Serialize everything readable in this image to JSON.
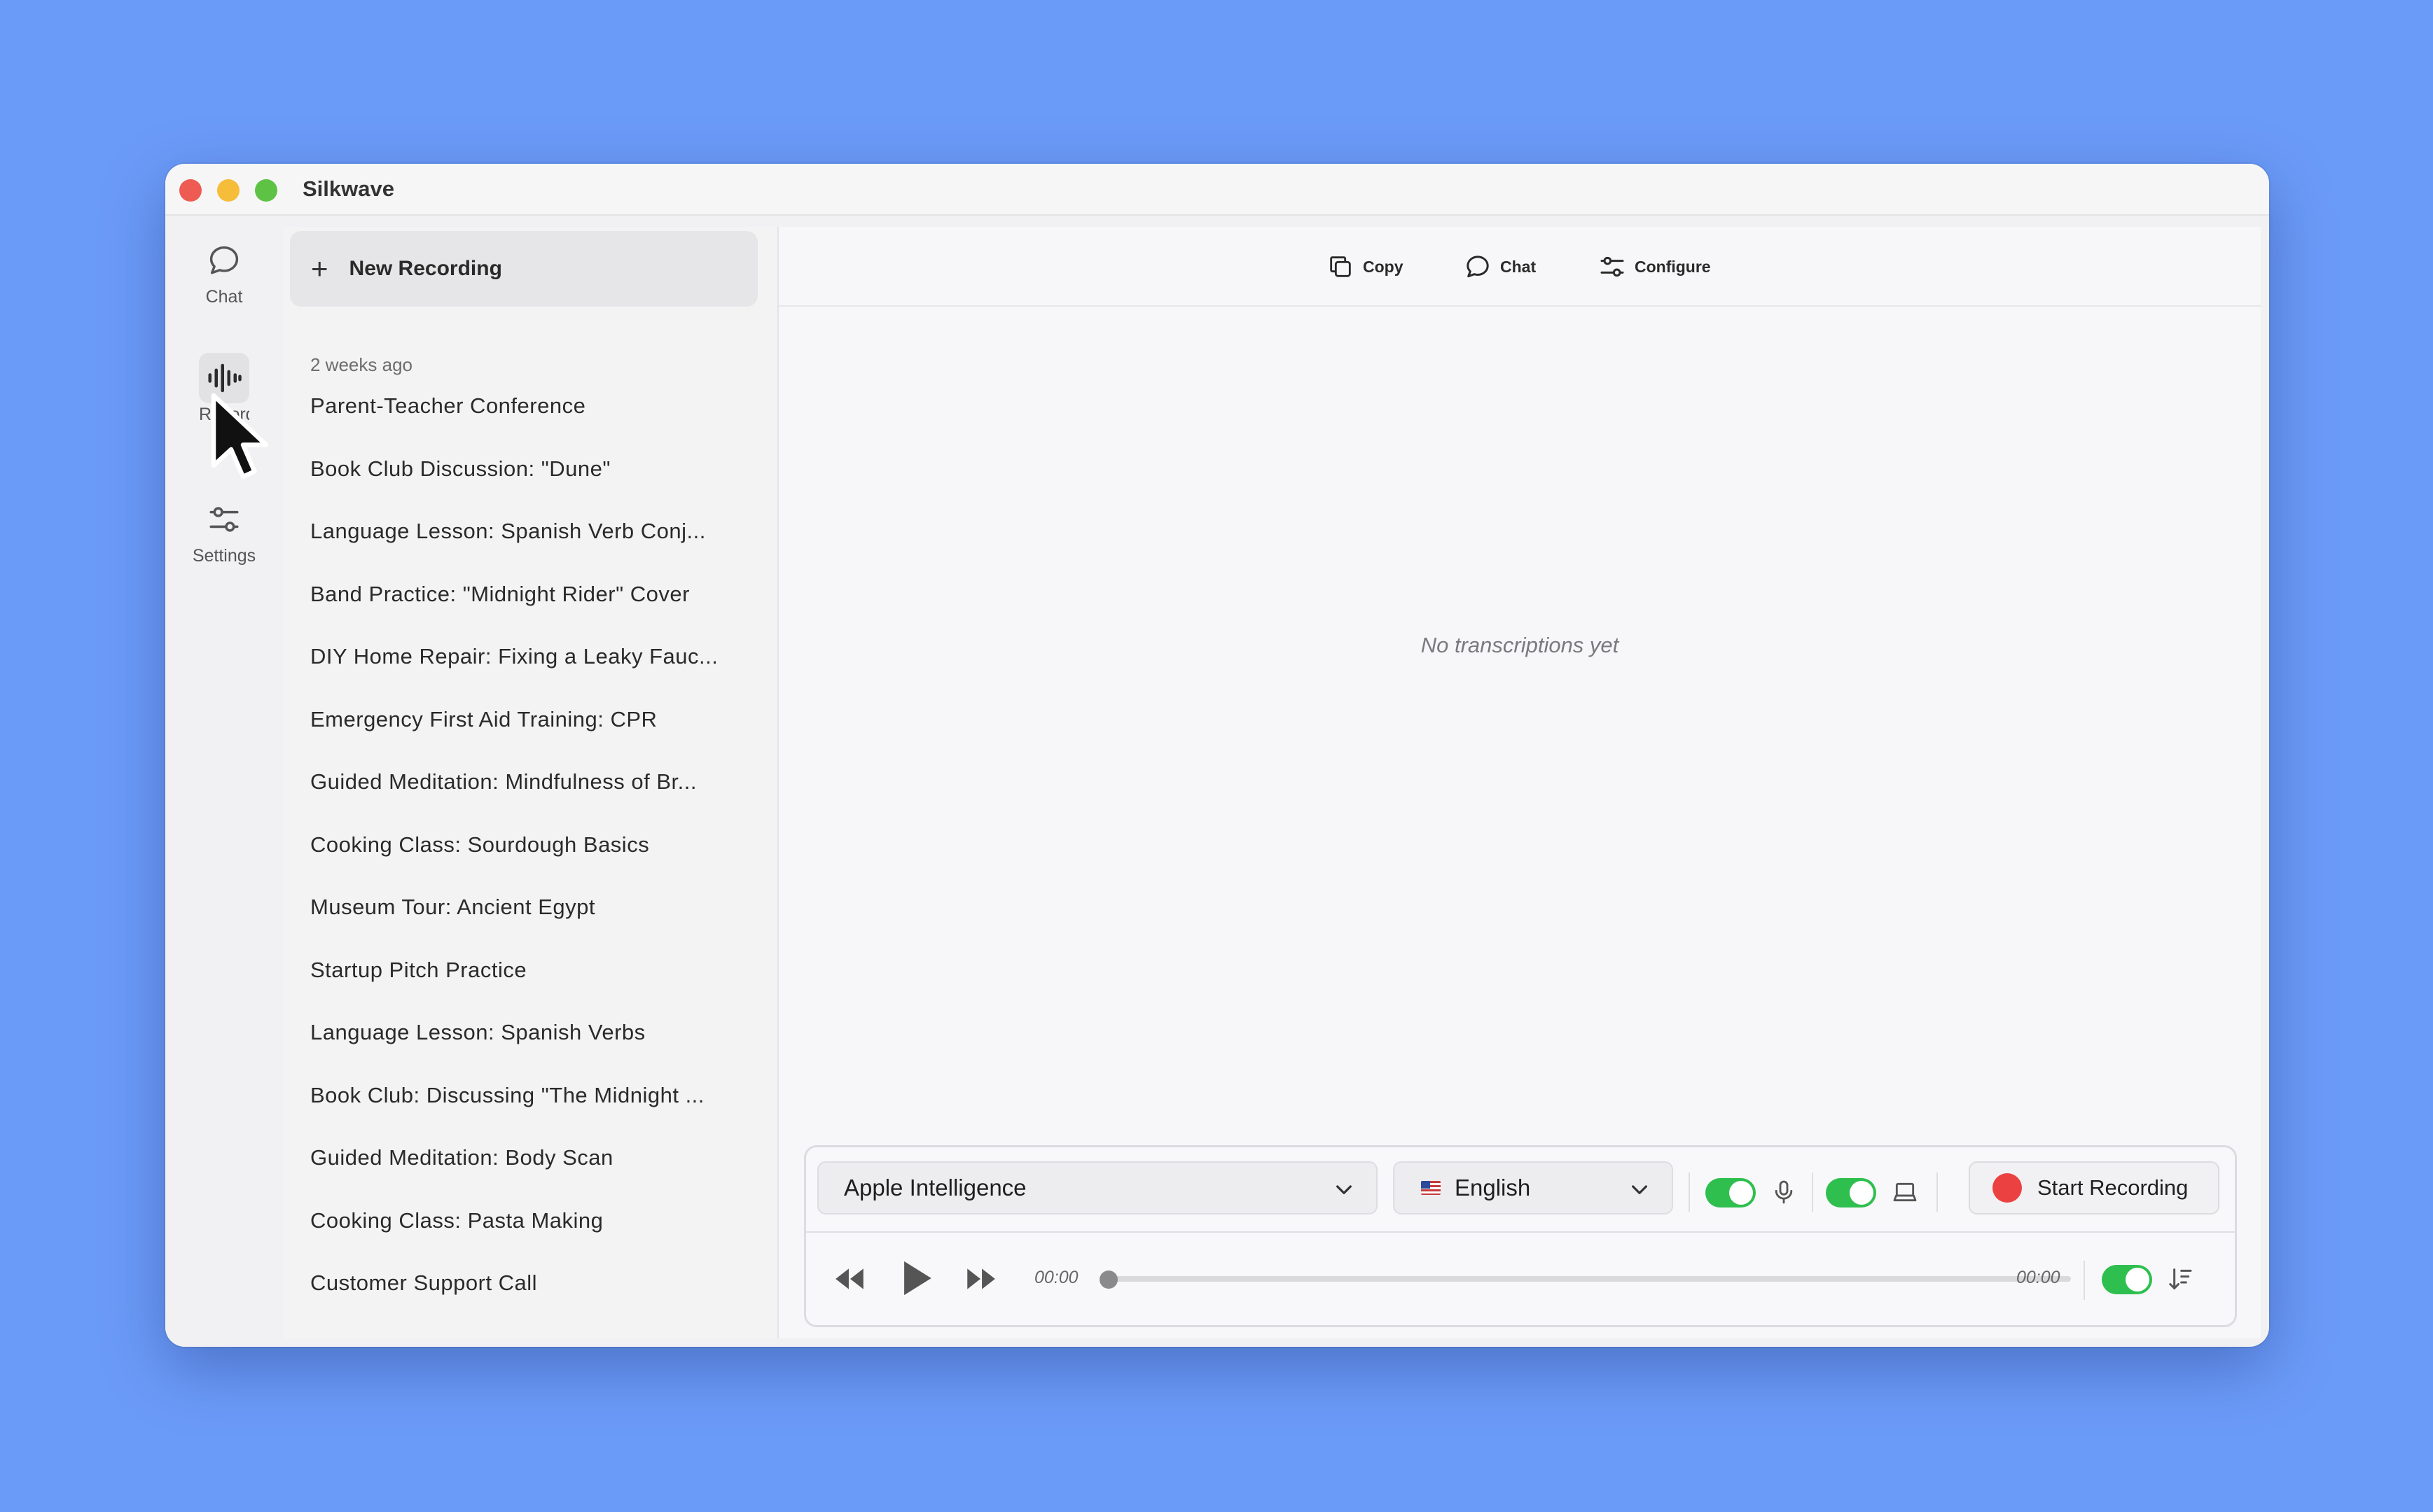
{
  "window": {
    "title": "Silkwave"
  },
  "rail": {
    "items": [
      {
        "label": "Chat",
        "icon": "chat-bubble-icon"
      },
      {
        "label": "Recordings",
        "icon": "waveform-icon",
        "active": true
      },
      {
        "label": "Settings",
        "icon": "sliders-icon"
      }
    ]
  },
  "list": {
    "new_button": "New Recording",
    "group_label": "2 weeks ago",
    "items": [
      "Parent-Teacher Conference",
      "Book Club Discussion: \"Dune\"",
      "Language Lesson: Spanish Verb Conj...",
      "Band Practice: \"Midnight Rider\" Cover",
      "DIY Home Repair: Fixing a Leaky Fauc...",
      "Emergency First Aid Training: CPR",
      "Guided Meditation: Mindfulness of Br...",
      "Cooking Class: Sourdough Basics",
      "Museum Tour: Ancient Egypt",
      "Startup Pitch Practice",
      "Language Lesson: Spanish Verbs",
      "Book Club: Discussing \"The Midnight ...",
      "Guided Meditation: Body Scan",
      "Cooking Class: Pasta Making",
      "Customer Support Call"
    ]
  },
  "toolbar": {
    "copy": "Copy",
    "chat": "Chat",
    "configure": "Configure"
  },
  "main": {
    "empty_text": "No transcriptions yet"
  },
  "controls": {
    "model": "Apple Intelligence",
    "language": "English",
    "mic_toggle_on": true,
    "system_audio_toggle_on": true,
    "record_button": "Start Recording",
    "time_current": "00:00",
    "time_total": "00:00",
    "autoscroll_toggle_on": true,
    "progress": 0
  },
  "colors": {
    "accent_green": "#2fbf4f",
    "record_red": "#ec4141",
    "background": "#6b9bf8"
  }
}
